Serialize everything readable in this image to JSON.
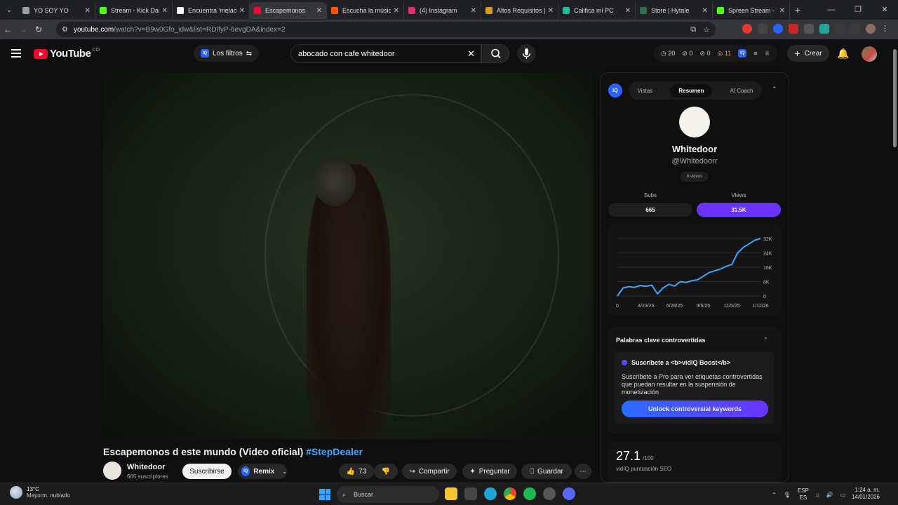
{
  "browser": {
    "tabs": [
      {
        "title": "YO SOY YO",
        "color": "#9aa0a6"
      },
      {
        "title": "Stream - Kick Dash",
        "color": "#53fc18"
      },
      {
        "title": "Encuentra 'melao'",
        "color": "#ffffff"
      },
      {
        "title": "Escapemonos",
        "color": "#ff0033"
      },
      {
        "title": "Escucha la música",
        "color": "#ff5500"
      },
      {
        "title": "(4) Instagram",
        "color": "#e1306c"
      },
      {
        "title": "Altos Requisitos |",
        "color": "#d4a017"
      },
      {
        "title": "Califica mi PC",
        "color": "#1abc9c"
      },
      {
        "title": "Store | Hytale",
        "color": "#2f6f4f"
      },
      {
        "title": "Spreen Stream - Vi",
        "color": "#53fc18"
      }
    ],
    "url_host": "youtube.com",
    "url_path": "/watch?v=B9w0Gfo_idw&list=RDIfyP-6evgDA&index=2"
  },
  "youtube": {
    "logo_text": "YouTube",
    "country": "CO",
    "filters_label": "Los filtros",
    "search_value": "abocado con cafe whitedoor",
    "stats": {
      "a": "20",
      "b": "0",
      "c": "0",
      "d": "11"
    },
    "create_label": "Crear"
  },
  "video": {
    "title": "Escapemonos d este mundo (Video oficial)",
    "hashtag": "#StepDealer",
    "channel": "Whitedoor",
    "subs": "665 suscriptores",
    "subscribe_label": "Suscribirse",
    "remix_label": "Remix",
    "likes": "73",
    "share_label": "Compartir",
    "ask_label": "Preguntar",
    "save_label": "Guardar"
  },
  "vidiq": {
    "tabs": [
      "Vistas",
      "Resumen",
      "AI Coach"
    ],
    "name": "Whitedoor",
    "handle": "@Whitedoorr",
    "videos": "8 videos",
    "subs_label": "Subs",
    "subs_value": "665",
    "views_label": "Views",
    "views_value": "31.5K",
    "accent": "#6a33ff",
    "chart_y_ticks": [
      "32K",
      "24K",
      "16K",
      "8K",
      "0"
    ],
    "chart_x_ticks": [
      "0",
      "4/23/25",
      "6/28/25",
      "9/5/25",
      "11/5/25",
      "1/12/26"
    ],
    "kw_title": "Palabras clave controvertidas",
    "kw_head": "Suscríbete a <b>vidIQ Boost</b>",
    "kw_body": "Suscríbete a Pro para ver etiquetas controvertidas que puedan resultar en la suspensión de monetización",
    "kw_button": "Unlock controversial keywords",
    "seo_value": "27.1",
    "seo_max": "/100",
    "seo_label": "vidIQ puntuación SEO"
  },
  "chart_data": {
    "type": "line",
    "title": "",
    "xlabel": "",
    "ylabel": "",
    "ylim": [
      0,
      32000
    ],
    "x_ticks": [
      "0",
      "4/23/25",
      "6/28/25",
      "9/5/25",
      "11/5/25",
      "1/12/26"
    ],
    "series": [
      {
        "values": [
          0,
          4500,
          5200,
          4800,
          5800,
          5400,
          6000,
          1200,
          4500,
          6500,
          5500,
          8000,
          7500,
          8500,
          9000,
          11000,
          13000,
          14000,
          15000,
          16500,
          17500,
          24000,
          27000,
          29000,
          31000,
          32000
        ]
      }
    ],
    "grid": true,
    "color": "#3ea6ff"
  },
  "taskbar": {
    "temp": "13°C",
    "weather": "Mayorm. nublado",
    "search_label": "Buscar",
    "lang1": "ESP",
    "lang2": "ES",
    "time": "1:24 a. m.",
    "date": "14/01/2026"
  }
}
